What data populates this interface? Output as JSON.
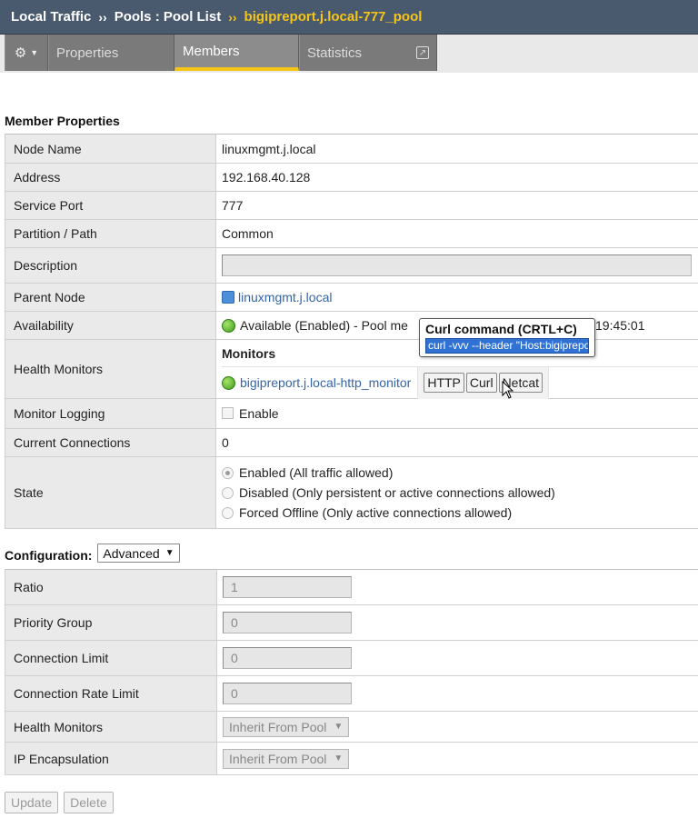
{
  "breadcrumb": {
    "root": "Local Traffic",
    "separator": "››",
    "section": "Pools : Pool List",
    "current": "bigipreport.j.local-777_pool"
  },
  "tabs": {
    "properties": "Properties",
    "members": "Members",
    "statistics": "Statistics"
  },
  "member_properties": {
    "heading": "Member Properties",
    "node_name": {
      "label": "Node Name",
      "value": "linuxmgmt.j.local"
    },
    "address": {
      "label": "Address",
      "value": "192.168.40.128"
    },
    "service_port": {
      "label": "Service Port",
      "value": "777"
    },
    "partition": {
      "label": "Partition / Path",
      "value": "Common"
    },
    "description": {
      "label": "Description",
      "value": ""
    },
    "parent_node": {
      "label": "Parent Node",
      "value": "linuxmgmt.j.local"
    },
    "availability": {
      "label": "Availability",
      "value_left": "Available (Enabled) - Pool me",
      "value_right": "19:45:01"
    },
    "health_monitors": {
      "label": "Health Monitors",
      "col_header": "Monitors",
      "monitor": "bigipreport.j.local-http_monitor",
      "buttons": [
        "HTTP",
        "Curl",
        "Netcat"
      ]
    },
    "monitor_logging": {
      "label": "Monitor Logging",
      "checkbox_label": "Enable"
    },
    "current_connections": {
      "label": "Current Connections",
      "value": "0"
    },
    "state": {
      "label": "State",
      "options": [
        "Enabled (All traffic allowed)",
        "Disabled (Only persistent or active connections allowed)",
        "Forced Offline (Only active connections allowed)"
      ],
      "selected": 0
    }
  },
  "tooltip": {
    "title": "Curl command (CRTL+C)",
    "command": "curl -vvv --header \"Host:bigipreport.j.local\""
  },
  "configuration": {
    "heading": "Configuration:",
    "mode": "Advanced",
    "ratio": {
      "label": "Ratio",
      "value": "1"
    },
    "priority_group": {
      "label": "Priority Group",
      "value": "0"
    },
    "connection_limit": {
      "label": "Connection Limit",
      "value": "0"
    },
    "connection_rate_limit": {
      "label": "Connection Rate Limit",
      "value": "0"
    },
    "health_monitors": {
      "label": "Health Monitors",
      "value": "Inherit From Pool"
    },
    "ip_encapsulation": {
      "label": "IP Encapsulation",
      "value": "Inherit From Pool"
    }
  },
  "actions": {
    "update": "Update",
    "delete": "Delete"
  },
  "colors": {
    "title_bar": "#4a5a6e",
    "breadcrumb_current": "#f5c518",
    "tab_active_underline": "#f5c518",
    "link": "#3564a8",
    "status_available": "#3d9a1c"
  },
  "icons": {
    "settings": "gear-icon",
    "popout": "popout-icon",
    "node": "node-icon",
    "status": "status-green-circle-icon"
  }
}
